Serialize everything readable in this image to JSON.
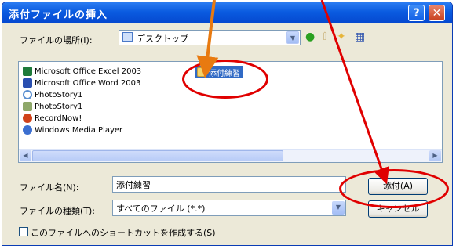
{
  "window": {
    "title": "添付ファイルの挿入",
    "help_glyph": "?",
    "close_glyph": "✕"
  },
  "lookin": {
    "label": "ファイルの場所(I):",
    "value": "デスクトップ"
  },
  "toolbar": {
    "back_icon": "back-icon",
    "up_icon": "up-folder-icon",
    "newfolder_icon": "new-folder-icon",
    "views_icon": "views-icon"
  },
  "files": [
    {
      "label": "Microsoft Office Excel 2003",
      "icon": "excel-icon",
      "color": "#1e7a3a"
    },
    {
      "label": "Microsoft Office Word 2003",
      "icon": "word-icon",
      "color": "#2a4fb0"
    },
    {
      "label": "PhotoStory1",
      "icon": "photostory-icon",
      "color": "#5a8fd0"
    },
    {
      "label": "PhotoStory1",
      "icon": "photostory-icon",
      "color": "#8fa86a"
    },
    {
      "label": "RecordNow!",
      "icon": "recordnow-icon",
      "color": "#d0421a"
    },
    {
      "label": "Windows Media Player",
      "icon": "media-player-icon",
      "color": "#3c6fd0"
    }
  ],
  "selected_folder": {
    "label": "添付練習",
    "icon": "folder-icon"
  },
  "filename": {
    "label": "ファイル名(N):",
    "value": "添付練習"
  },
  "filetype": {
    "label": "ファイルの種類(T):",
    "value": "すべてのファイル (*.*)"
  },
  "buttons": {
    "attach": "添付(A)",
    "cancel": "キャンセル"
  },
  "shortcut_checkbox": {
    "label": "このファイルへのショートカットを作成する(S)",
    "checked": false
  },
  "colors": {
    "annotation_red": "#e00000",
    "annotation_orange": "#e87a10",
    "selection_blue": "#316ac5"
  }
}
